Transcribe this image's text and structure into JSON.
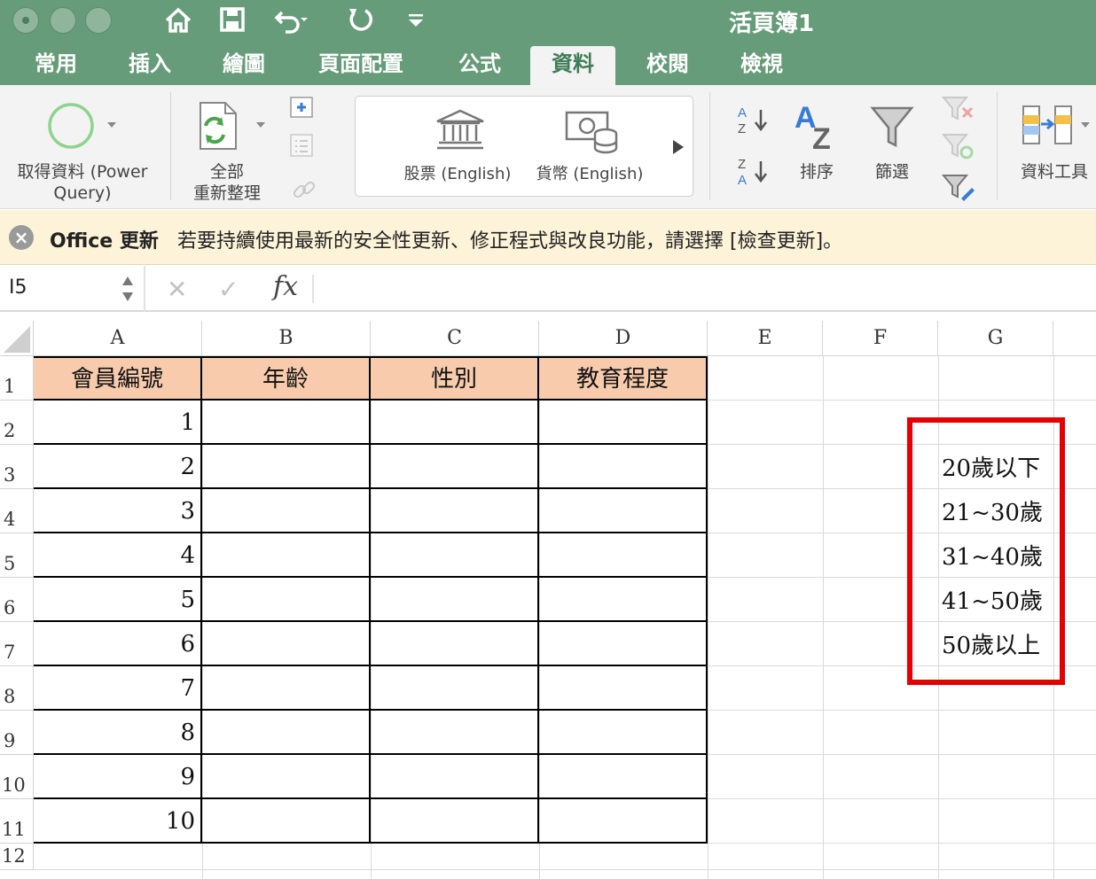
{
  "window": {
    "title": "活頁簿1"
  },
  "tabs": [
    "常用",
    "插入",
    "繪圖",
    "頁面配置",
    "公式",
    "資料",
    "校閱",
    "檢視"
  ],
  "active_tab": "資料",
  "ribbon": {
    "get_data": "取得資料 (Power Query)",
    "get_data_line1": "取得資料 (Power",
    "get_data_line2": "Query)",
    "refresh_line1": "全部",
    "refresh_line2": "重新整理",
    "stocks": "股票 (English)",
    "currency": "貨幣 (English)",
    "sort": "排序",
    "filter": "篩選",
    "data_tools": "資料工具"
  },
  "message_bar": {
    "title": "Office 更新",
    "text": "若要持續使用最新的安全性更新、修正程式與改良功能，請選擇 [檢查更新]。"
  },
  "formula_bar": {
    "cell_ref": "I5",
    "formula": ""
  },
  "grid": {
    "columns": [
      "A",
      "B",
      "C",
      "D",
      "E",
      "F",
      "G"
    ],
    "rows": [
      "1",
      "2",
      "3",
      "4",
      "5",
      "6",
      "7",
      "8",
      "9",
      "10",
      "11",
      "12"
    ],
    "headers": [
      "會員編號",
      "年齡",
      "性別",
      "教育程度"
    ],
    "member_ids": [
      "1",
      "2",
      "3",
      "4",
      "5",
      "6",
      "7",
      "8",
      "9",
      "10"
    ],
    "age_groups": [
      "20歲以下",
      "21~30歲",
      "31~40歲",
      "41~50歲",
      "50歲以上"
    ]
  },
  "colors": {
    "title_bar": "#669c79",
    "header_fill": "#f8cbad",
    "highlight_box": "#e60000"
  }
}
